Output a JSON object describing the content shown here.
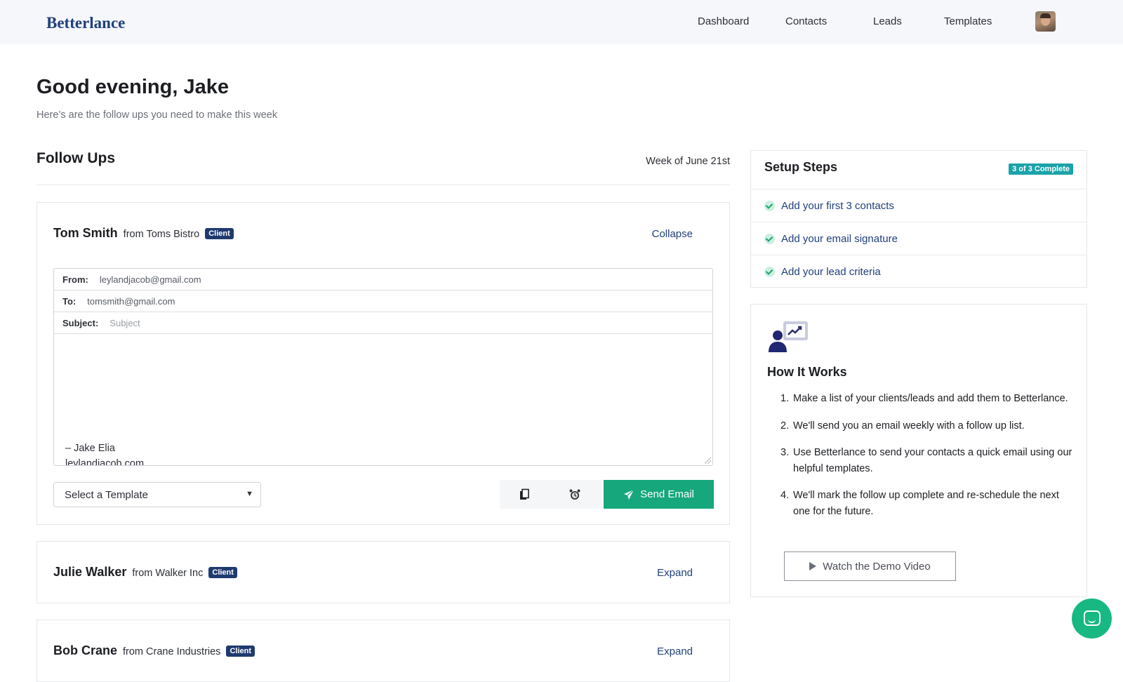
{
  "app": {
    "brand": "Betterlance"
  },
  "nav": {
    "items": [
      "Dashboard",
      "Contacts",
      "Leads",
      "Templates"
    ]
  },
  "header": {
    "greeting": "Good evening, Jake",
    "subtitle": "Here’s are the follow ups you need to make this week"
  },
  "followups": {
    "title": "Follow Ups",
    "week": "Week of June 21st",
    "cards": [
      {
        "name": "Tom Smith",
        "company": "from Toms Bistro",
        "badge": "Client",
        "toggle": "Collapse",
        "email": {
          "from_label": "From:",
          "from_value": "leylandjacob@gmail.com",
          "to_label": "To:",
          "to_value": "tomsmith@gmail.com",
          "subject_label": "Subject:",
          "subject_placeholder": "Subject",
          "signature_line1": "– Jake Elia",
          "signature_line2": "leylandjacob.com"
        },
        "template_select": "Select a Template",
        "send_label": "Send Email"
      },
      {
        "name": "Julie Walker",
        "company": "from Walker Inc",
        "badge": "Client",
        "toggle": "Expand"
      },
      {
        "name": "Bob Crane",
        "company": "from Crane Industries",
        "badge": "Client",
        "toggle": "Expand"
      }
    ]
  },
  "setup": {
    "title": "Setup Steps",
    "badge": "3 of 3 Complete",
    "steps": [
      "Add your first 3 contacts",
      "Add your email signature",
      "Add your lead criteria"
    ]
  },
  "how": {
    "title": "How It Works",
    "steps": [
      "Make a list of your clients/leads and add them to Betterlance.",
      "We'll send you an email weekly with a follow up list.",
      "Use Betterlance to send your contacts a quick email using our helpful templates.",
      "We'll mark the follow up complete and re-schedule the next one for the future."
    ],
    "demo_button": "Watch the Demo Video"
  },
  "colors": {
    "brand": "#20407a",
    "send": "#16a77c",
    "badge_teal": "#1aa3a8",
    "chat": "#17b882"
  },
  "icons": [
    "copy-icon",
    "alarm-clock-icon",
    "send-paper-plane-icon",
    "checkmark-icon",
    "presentation-user-icon",
    "play-icon",
    "chat-icon"
  ]
}
